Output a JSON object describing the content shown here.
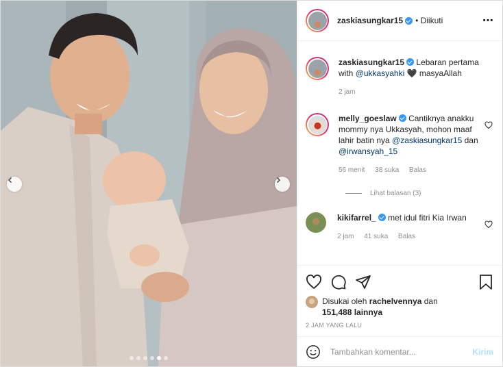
{
  "post": {
    "author": "zaskiasungkar15",
    "follow_status": "• Diikuti",
    "more_icon": "⋯"
  },
  "photo": {
    "image_desc_icon": "family-photo",
    "dots_total": 6,
    "dots_active_index": 4
  },
  "comments": [
    {
      "user": "zaskiasungkar15",
      "verified": true,
      "text_before": "Lebaran pertama with ",
      "mention": "@ukkasyahki",
      "text_after": " 🖤 masyaAllah",
      "time": "2 jam"
    },
    {
      "user": "melly_goeslaw",
      "verified": true,
      "text": "Cantiknya anakku mommy nya Ukkasyah, mohon maaf lahir batin nya ",
      "mention1": "@zaskiasungkar15",
      "joiner": " dan ",
      "mention2": "@irwansyah_15",
      "time": "56 menit",
      "likes": "38 suka",
      "reply": "Balas",
      "view_replies": "Lihat balasan (3)"
    },
    {
      "user": "kikifarrel_",
      "verified": true,
      "text": "met idul fitri Kia Irwan",
      "time": "2 jam",
      "likes": "41 suka",
      "reply": "Balas"
    }
  ],
  "likes": {
    "prefix": "Disukai oleh ",
    "user": "rachelvennya",
    "joiner": " dan",
    "count": "151,488 lainnya"
  },
  "timestamp": "2 JAM YANG LALU",
  "composer": {
    "placeholder": "Tambahkan komentar...",
    "send": "Kirim"
  }
}
